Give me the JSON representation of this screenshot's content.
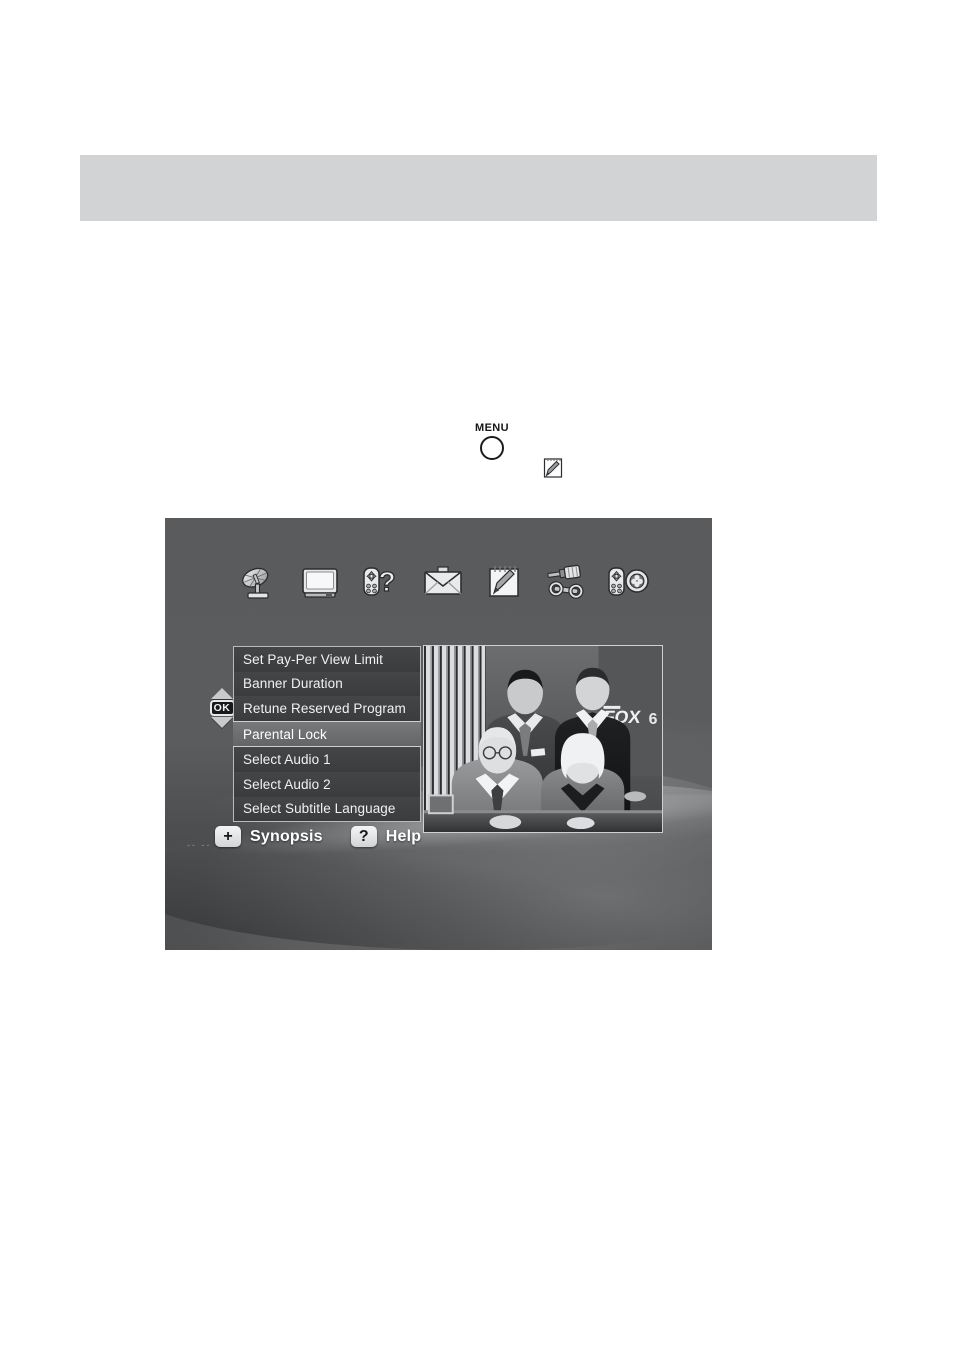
{
  "page": {
    "background_color": "#ffffff",
    "header_band": {
      "color": "#d2d3d5",
      "text": ""
    }
  },
  "callout": {
    "menu_button_label": "MENU",
    "notepad_icon": "notepad-pencil-icon"
  },
  "tv": {
    "screen_background_color": "#555759",
    "icon_bar": {
      "items": [
        {
          "icon": "satellite-dish-icon",
          "name": "antenna"
        },
        {
          "icon": "television-icon",
          "name": "tv"
        },
        {
          "icon": "remote-question-icon",
          "name": "help"
        },
        {
          "icon": "envelope-icon",
          "name": "messages"
        },
        {
          "icon": "notepad-pencil-icon",
          "name": "notes"
        },
        {
          "icon": "screwdriver-wrench-icon",
          "name": "setup"
        },
        {
          "icon": "remote-clover-icon",
          "name": "games"
        }
      ]
    },
    "menu": {
      "selected_index": 3,
      "items": [
        {
          "label": "Set Pay-Per View Limit",
          "selected": false
        },
        {
          "label": "Banner Duration",
          "selected": false
        },
        {
          "label": "Retune Reserved Program",
          "selected": false
        },
        {
          "label": "Parental Lock",
          "selected": true
        },
        {
          "label": "Select Audio 1",
          "selected": false
        },
        {
          "label": "Select Audio 2",
          "selected": false
        },
        {
          "label": "Select Subtitle Language",
          "selected": false
        }
      ],
      "ok_badge_label": "OK",
      "scroll_up_icon": "triangle-up-icon",
      "scroll_down_icon": "triangle-down-icon"
    },
    "preview": {
      "description": "news-team-photo",
      "station_logo": "FOX",
      "station_number": "6"
    },
    "actions": [
      {
        "glyph": "+",
        "label": "Synopsis",
        "icon": "plus-icon"
      },
      {
        "glyph": "?",
        "label": "Help",
        "icon": "question-mark-icon"
      }
    ],
    "tick_marks": "--  --"
  }
}
